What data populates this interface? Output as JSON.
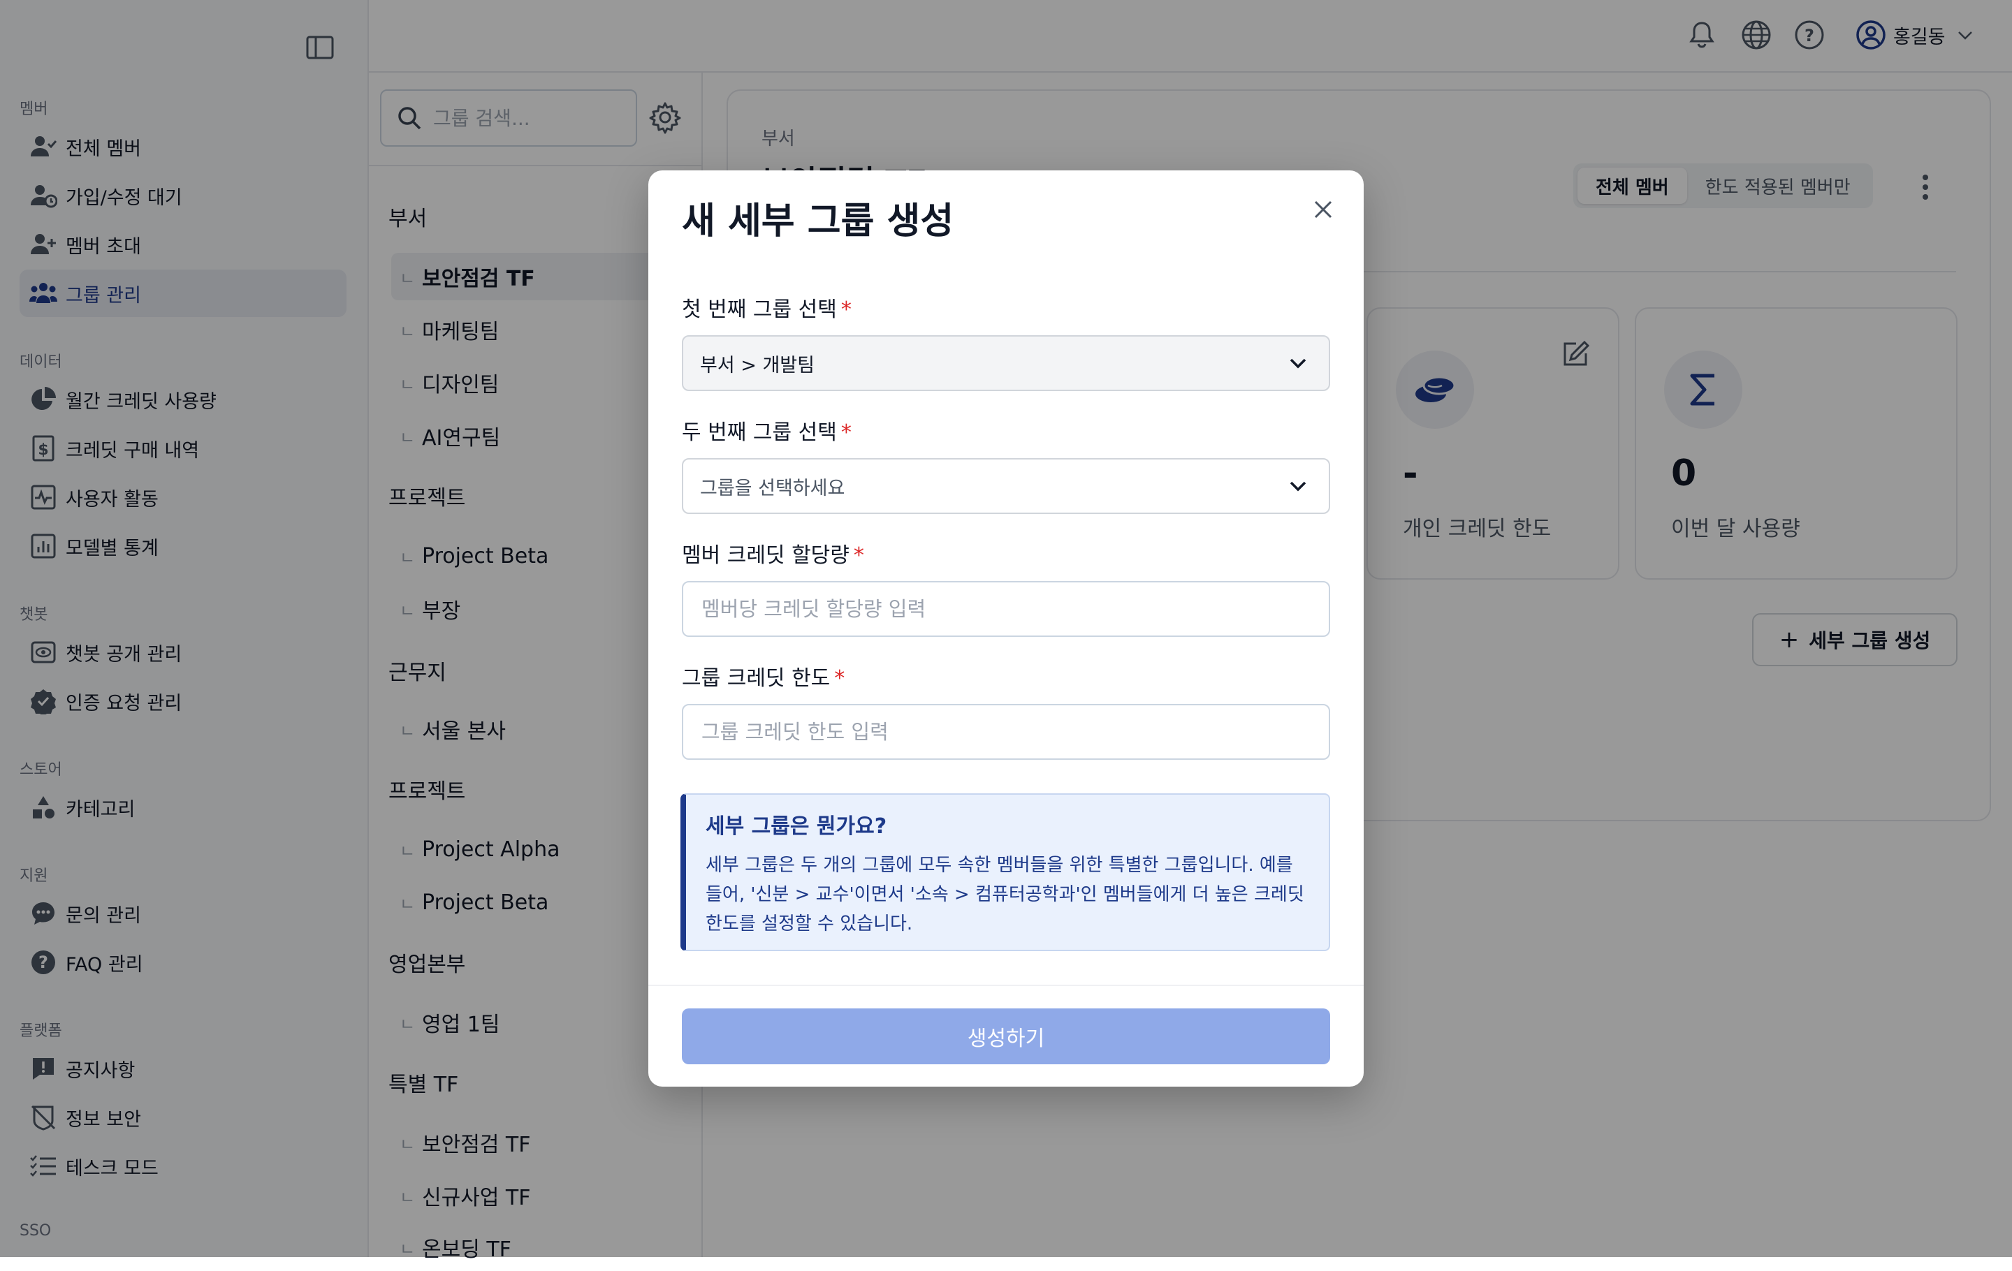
{
  "sidebar": {
    "sections": [
      {
        "title": "멤버",
        "items": [
          {
            "label": "전체 멤버",
            "icon": "user-check-icon"
          },
          {
            "label": "가입/수정 대기",
            "icon": "user-clock-icon"
          },
          {
            "label": "멤버 초대",
            "icon": "user-plus-icon"
          },
          {
            "label": "그룹 관리",
            "icon": "users-icon",
            "active": true
          }
        ]
      },
      {
        "title": "데이터",
        "items": [
          {
            "label": "월간 크레딧 사용량",
            "icon": "pie-chart-icon"
          },
          {
            "label": "크레딧 구매 내역",
            "icon": "dollar-receipt-icon"
          },
          {
            "label": "사용자 활동",
            "icon": "activity-icon"
          },
          {
            "label": "모델별 통계",
            "icon": "bar-chart-icon"
          }
        ]
      },
      {
        "title": "챗봇",
        "items": [
          {
            "label": "챗봇 공개 관리",
            "icon": "eye-icon"
          },
          {
            "label": "인증 요청 관리",
            "icon": "verified-badge-icon"
          }
        ]
      },
      {
        "title": "스토어",
        "items": [
          {
            "label": "카테고리",
            "icon": "shapes-icon"
          }
        ]
      },
      {
        "title": "지원",
        "items": [
          {
            "label": "문의 관리",
            "icon": "chat-bubble-icon"
          },
          {
            "label": "FAQ 관리",
            "icon": "question-circle-icon"
          }
        ]
      },
      {
        "title": "플랫폼",
        "items": [
          {
            "label": "공지사항",
            "icon": "alert-message-icon"
          },
          {
            "label": "정보 보안",
            "icon": "shield-off-icon"
          },
          {
            "label": "테스크 모드",
            "icon": "list-check-icon"
          }
        ]
      },
      {
        "title": "SSO",
        "items": []
      }
    ]
  },
  "topbar": {
    "user_name": "홍길동",
    "icons": [
      "bell-icon",
      "globe-icon",
      "help-icon",
      "user-circle-icon"
    ]
  },
  "groups": {
    "search_placeholder": "그룹 검색...",
    "tree": [
      {
        "name": "부서",
        "children": [
          "보안점검 TF",
          "마케팅팀",
          "디자인팀",
          "AI연구팀"
        ]
      },
      {
        "name": "프로젝트",
        "children": [
          "Project Beta",
          "부장"
        ]
      },
      {
        "name": "근무지",
        "children": [
          "서울 본사"
        ]
      },
      {
        "name": "프로젝트",
        "children": [
          "Project Alpha",
          "Project Beta"
        ]
      },
      {
        "name": "영업본부",
        "children": [
          "영업 1팀"
        ]
      },
      {
        "name": "특별 TF",
        "children": [
          "보안점검 TF",
          "신규사업 TF",
          "온보딩 TF"
        ]
      }
    ],
    "selected": "보안점검 TF",
    "branch_glyph": "ㄴ"
  },
  "main": {
    "breadcrumb": "부서",
    "title": "보안점검 TF",
    "segment": {
      "all": "전체 멤버",
      "limited": "한도 적용된 멤버만"
    },
    "stats": [
      {
        "value": "-",
        "label": "개인 크레딧 한도",
        "icon": "coins-icon"
      },
      {
        "value": "0",
        "label": "이번 달 사용량",
        "icon": "sigma-icon"
      }
    ],
    "add_subgroup_label": "세부 그룹 생성",
    "add_plus": "+"
  },
  "modal": {
    "title": "새 세부 그룹 생성",
    "fields": {
      "first_group": {
        "label": "첫 번째 그룹 선택",
        "value": "부서 > 개발팀"
      },
      "second_group": {
        "label": "두 번째 그룹 선택",
        "placeholder": "그룹을 선택하세요"
      },
      "member_credit": {
        "label": "멤버 크레딧 할당량",
        "placeholder": "멤버당 크레딧 할당량 입력"
      },
      "group_credit": {
        "label": "그룹 크레딧 한도",
        "placeholder": "그룹 크레딧 한도 입력"
      }
    },
    "required_mark": "*",
    "info": {
      "title": "세부 그룹은 뭔가요?",
      "body": "세부 그룹은 두 개의 그룹에 모두 속한 멤버들을 위한 특별한 그룹입니다. 예를 들어, '신분 > 교수'이면서 '소속 > 컴퓨터공학과'인 멤버들에게 더 높은 크레딧 한도를 설정할 수 있습니다."
    },
    "submit_label": "생성하기"
  },
  "colors": {
    "accent": "#1e3a8a",
    "required": "#dc2626",
    "submit_disabled": "#8fa9e8",
    "overlay": "rgba(0,0,0,0.40)"
  }
}
